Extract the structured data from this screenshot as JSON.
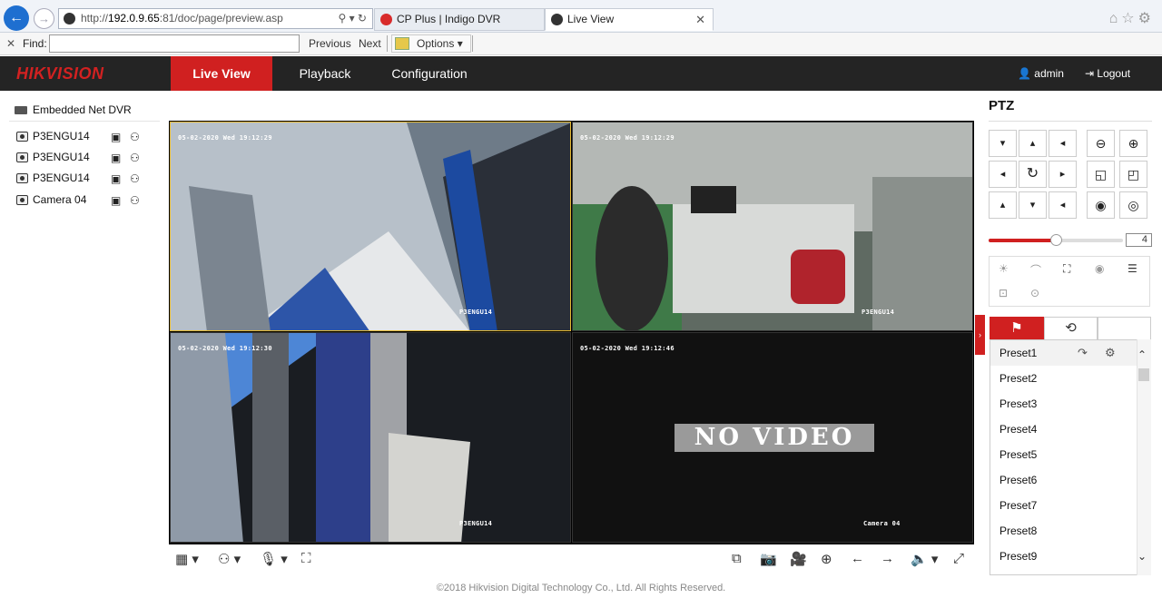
{
  "browser": {
    "url_prefix": "http://",
    "url_host": "192.0.9.65",
    "url_rest": ":81/doc/page/preview.asp",
    "url_tools": "⚲ ▾ ↻",
    "tabs": [
      {
        "title": "CP Plus | Indigo DVR",
        "color": "#d82b2b"
      },
      {
        "title": "Live View",
        "close": "✕",
        "color": "#333333"
      }
    ],
    "nav_back": "←",
    "nav_forward": "→",
    "right_icons": "⌂☆⚙"
  },
  "find_bar": {
    "close": "✕",
    "label": "Find:",
    "value": "",
    "previous": "Previous",
    "next": "Next",
    "options": "Options ▾"
  },
  "app": {
    "logo": "HIKVISION",
    "nav": [
      "Live View",
      "Playback",
      "Configuration"
    ],
    "active_nav": 0,
    "user": "admin",
    "logout": "Logout",
    "user_icon": "person-icon",
    "logout_icon": "logout-icon",
    "accent": "#d02020"
  },
  "device_tree": {
    "root": "Embedded Net DVR",
    "cameras": [
      "P3ENGU14",
      "P3ENGU14",
      "P3ENGU14",
      "Camera 04"
    ]
  },
  "video": {
    "panes": [
      {
        "timestamp": "05-02-2020 Wed 19:12:29",
        "label": "P3ENGU14",
        "selected": true,
        "no_video": false
      },
      {
        "timestamp": "05-02-2020 Wed 19:12:29",
        "label": "P3ENGU14",
        "selected": false,
        "no_video": false
      },
      {
        "timestamp": "05-02-2020 Wed 19:12:30",
        "label": "P3ENGU14",
        "selected": false,
        "no_video": false
      },
      {
        "timestamp": "05-02-2020 Wed 19:12:46",
        "label": "Camera 04",
        "selected": false,
        "no_video": true
      }
    ],
    "no_video_text": "NO VIDEO",
    "toolbar_left": [
      "▦ ▾",
      "⚇ ▾",
      "🎙 ▾",
      "⛶"
    ],
    "toolbar_right": [
      "⧉",
      "📷",
      "🎥",
      "⊕",
      "←",
      "→",
      "🔈 ▾",
      "⤢"
    ]
  },
  "ptz": {
    "title": "PTZ",
    "speed": "4",
    "speed_level": 0.5,
    "direction_buttons": [
      "▾",
      "▴",
      "◂",
      "◂",
      "↻",
      "▸",
      "▴",
      "▾",
      "◂"
    ],
    "zoom_buttons": [
      "⊖",
      "⊕",
      "◱",
      "◰",
      "◉",
      "◎"
    ],
    "aux_icons": [
      "☀",
      "⌒",
      "⛶",
      "◉",
      "☰",
      "⊡",
      "⊙"
    ],
    "tabs": [
      "⚑",
      "⟲",
      ""
    ],
    "presets": [
      "Preset1",
      "Preset2",
      "Preset3",
      "Preset4",
      "Preset5",
      "Preset6",
      "Preset7",
      "Preset8",
      "Preset9"
    ],
    "preset_actions": [
      "↷",
      "⚙"
    ],
    "scroll_up": "⌃",
    "scroll_down": "⌄",
    "side_toggle": "›"
  },
  "footer": {
    "copyright": "©2018 Hikvision Digital Technology Co., Ltd. All Rights Reserved."
  }
}
